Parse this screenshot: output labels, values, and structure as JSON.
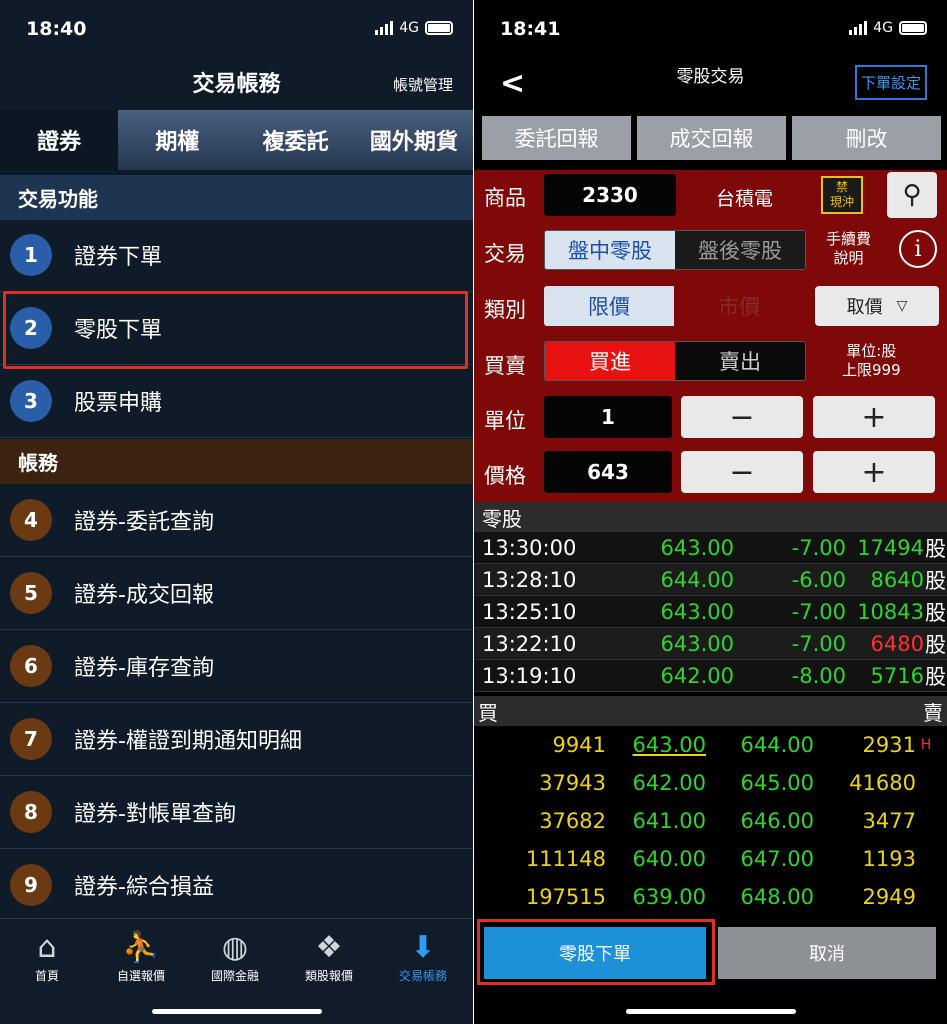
{
  "left": {
    "status": {
      "time": "18:40",
      "network": "4G"
    },
    "title": "交易帳務",
    "account_mgmt": "帳號管理",
    "tabs": [
      {
        "label": "證券",
        "active": true
      },
      {
        "label": "期權",
        "active": false
      },
      {
        "label": "複委託",
        "active": false
      },
      {
        "label": "國外期貨",
        "active": false
      }
    ],
    "section_trade": "交易功能",
    "trade_items": [
      {
        "num": "1",
        "label": "證券下單"
      },
      {
        "num": "2",
        "label": "零股下單"
      },
      {
        "num": "3",
        "label": "股票申購"
      }
    ],
    "section_account": "帳務",
    "account_items": [
      {
        "num": "4",
        "label": "證券-委託查詢"
      },
      {
        "num": "5",
        "label": "證券-成交回報"
      },
      {
        "num": "6",
        "label": "證券-庫存查詢"
      },
      {
        "num": "7",
        "label": "證券-權證到期通知明細"
      },
      {
        "num": "8",
        "label": "證券-對帳單查詢"
      },
      {
        "num": "9",
        "label": "證券-綜合損益"
      }
    ],
    "nav": [
      {
        "label": "首頁",
        "icon": "home-icon"
      },
      {
        "label": "自選報價",
        "icon": "user-chart-icon"
      },
      {
        "label": "國際金融",
        "icon": "globe-icon"
      },
      {
        "label": "類股報價",
        "icon": "stocks-icon"
      },
      {
        "label": "交易帳務",
        "icon": "tray-download-icon",
        "active": true
      }
    ],
    "colors": {
      "highlight": "#e0301e",
      "active_tab": "#2a9df4"
    }
  },
  "right": {
    "status": {
      "time": "18:41",
      "network": "4G"
    },
    "title": "零股交易",
    "order_settings": "下單設定",
    "top_buttons": [
      "委託回報",
      "成交回報",
      "刪改"
    ],
    "form": {
      "product_label": "商品",
      "product_code": "2330",
      "product_name": "台積電",
      "badge": "禁\n現沖",
      "trade_label": "交易",
      "trade_options": [
        "盤中零股",
        "盤後零股"
      ],
      "fee_info": "手續費\n說明",
      "type_label": "類別",
      "type_options": [
        "限價",
        "市價"
      ],
      "price_source": "取價",
      "side_label": "買賣",
      "side_options": [
        "買進",
        "賣出"
      ],
      "unit_note": "單位:股\n上限999",
      "unit_label": "單位",
      "unit_value": "1",
      "price_label": "價格",
      "price_value": "643",
      "minus": "−",
      "plus": "+"
    },
    "trades_header": "零股",
    "trades": [
      {
        "time": "13:30:00",
        "price": "643.00",
        "change": "-7.00",
        "volume": "17494",
        "unit": "股",
        "red": false
      },
      {
        "time": "13:28:10",
        "price": "644.00",
        "change": "-6.00",
        "volume": "8640",
        "unit": "股",
        "red": false
      },
      {
        "time": "13:25:10",
        "price": "643.00",
        "change": "-7.00",
        "volume": "10843",
        "unit": "股",
        "red": false
      },
      {
        "time": "13:22:10",
        "price": "643.00",
        "change": "-7.00",
        "volume": "6480",
        "unit": "股",
        "red": true
      },
      {
        "time": "13:19:10",
        "price": "642.00",
        "change": "-8.00",
        "volume": "5716",
        "unit": "股",
        "red": false
      }
    ],
    "book_header": {
      "buy": "買",
      "sell": "賣"
    },
    "book": [
      {
        "bid_qty": "9941",
        "bid_price": "643.00",
        "ask_price": "644.00",
        "ask_qty": "2931",
        "mark": "H"
      },
      {
        "bid_qty": "37943",
        "bid_price": "642.00",
        "ask_price": "645.00",
        "ask_qty": "41680",
        "mark": ""
      },
      {
        "bid_qty": "37682",
        "bid_price": "641.00",
        "ask_price": "646.00",
        "ask_qty": "3477",
        "mark": ""
      },
      {
        "bid_qty": "111148",
        "bid_price": "640.00",
        "ask_price": "647.00",
        "ask_qty": "1193",
        "mark": ""
      },
      {
        "bid_qty": "197515",
        "bid_price": "639.00",
        "ask_price": "648.00",
        "ask_qty": "2949",
        "mark": ""
      }
    ],
    "submit": "零股下單",
    "cancel": "取消",
    "colors": {
      "form_bg": "#7f0808",
      "up": "#ff3030",
      "down": "#2dd52d",
      "qty": "#ecd21a",
      "submit": "#1c91d8"
    }
  }
}
